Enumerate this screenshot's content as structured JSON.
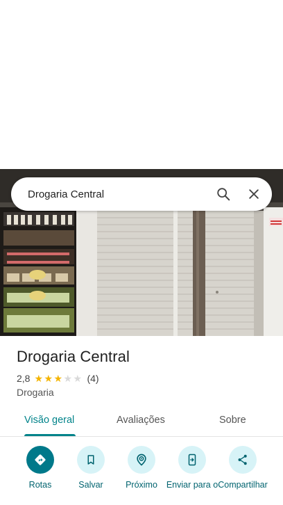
{
  "search": {
    "query": "Drogaria Central",
    "search_icon": "search-icon",
    "close_icon": "close-icon"
  },
  "place": {
    "name": "Drogaria Central",
    "rating": "2,8",
    "rating_fraction": 0.56,
    "stars_filled": 3,
    "stars_total": 5,
    "review_count": "(4)",
    "category": "Drogaria"
  },
  "tabs": [
    {
      "label": "Visão geral",
      "active": true
    },
    {
      "label": "Avaliações",
      "active": false
    },
    {
      "label": "Sobre",
      "active": false
    }
  ],
  "actions": [
    {
      "label": "Rotas",
      "icon": "directions-icon"
    },
    {
      "label": "Salvar",
      "icon": "bookmark-icon"
    },
    {
      "label": "Próximo",
      "icon": "nearby-icon"
    },
    {
      "label": "Enviar para o",
      "icon": "send-to-phone-icon"
    },
    {
      "label": "Compartilhar",
      "icon": "share-icon"
    }
  ],
  "colors": {
    "accent": "#00838a",
    "primary_action": "#00798a",
    "action_bg": "#d7f3f7",
    "star": "#f4b400"
  }
}
